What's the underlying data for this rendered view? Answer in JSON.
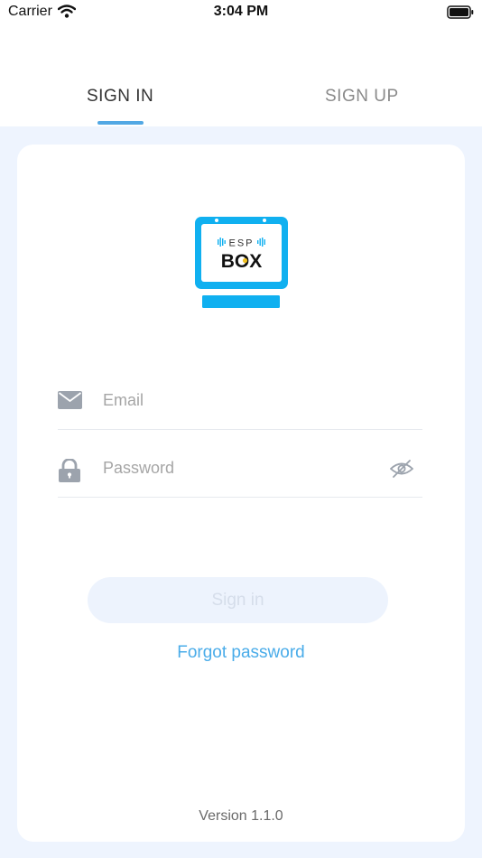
{
  "status_bar": {
    "carrier": "Carrier",
    "time": "3:04 PM"
  },
  "tabs": [
    {
      "label": "SIGN IN",
      "active": true
    },
    {
      "label": "SIGN UP",
      "active": false
    }
  ],
  "logo": {
    "text_top": "ESP",
    "text_main": "BOX",
    "color": "#10b0f0"
  },
  "form": {
    "email": {
      "placeholder": "Email",
      "value": "",
      "icon": "mail-icon"
    },
    "password": {
      "placeholder": "Password",
      "value": "",
      "icon": "lock-icon",
      "toggle_icon": "eye-hidden-icon"
    },
    "sign_in_label": "Sign in",
    "forgot_label": "Forgot password"
  },
  "footer": {
    "version": "Version 1.1.0"
  },
  "colors": {
    "accent": "#52a8e4",
    "link": "#4aace9",
    "background": "#eef4fe",
    "button_disabled": "#edf3fd"
  }
}
